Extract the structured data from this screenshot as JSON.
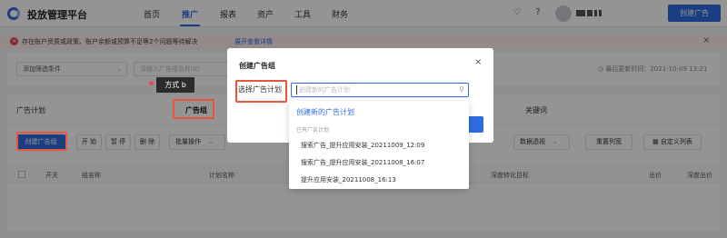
{
  "app": {
    "title": "投放管理平台"
  },
  "nav": {
    "items": [
      {
        "label": "首页"
      },
      {
        "label": "推广"
      },
      {
        "label": "报表"
      },
      {
        "label": "资产"
      },
      {
        "label": "工具"
      },
      {
        "label": "财务"
      }
    ],
    "active_index": 1,
    "create_ad_label": "创建广告"
  },
  "alert": {
    "text": "存在账户资质或政策、账户余额或预算不足等2个问题等待解决",
    "link": "展开查看详情"
  },
  "filters": {
    "add_filter_label": "添加筛选条件",
    "search_placeholder": "请输入广告组名称/ID",
    "update_time": "最后更新时间：2021-10-09 13:21"
  },
  "tabs": [
    {
      "label": "广告计划"
    },
    {
      "label": "广告组"
    },
    {
      "label": "关键词"
    }
  ],
  "toolbar": {
    "create_group": "创建广告组",
    "start": "开 始",
    "pause": "暂 停",
    "delete": "删 除",
    "batch": "批量操作",
    "data_view": "数据透视",
    "reset_columns": "重置列宽",
    "custom_columns": "自定义列表"
  },
  "table": {
    "headers": [
      "开关",
      "组名称",
      "计划名称",
      "深度转化目标",
      "出价",
      "深度出价"
    ]
  },
  "annotation": {
    "label": "方式 b"
  },
  "modal": {
    "title": "创建广告组",
    "field_label": "选择广告计划",
    "placeholder": "创建新的广告计划",
    "dropdown": {
      "create_new": "创建新的广告计划",
      "group_label": "已有广告计划",
      "items": [
        "搜索广告_提升应用安装_20211009_12:09",
        "搜索广告_提升应用安装_20211008_16:07",
        "提升应用安装_20211008_16:13"
      ]
    }
  },
  "colors": {
    "primary": "#2f6be0",
    "annotation": "#e8553f",
    "alert_bg": "#fdeeee"
  }
}
